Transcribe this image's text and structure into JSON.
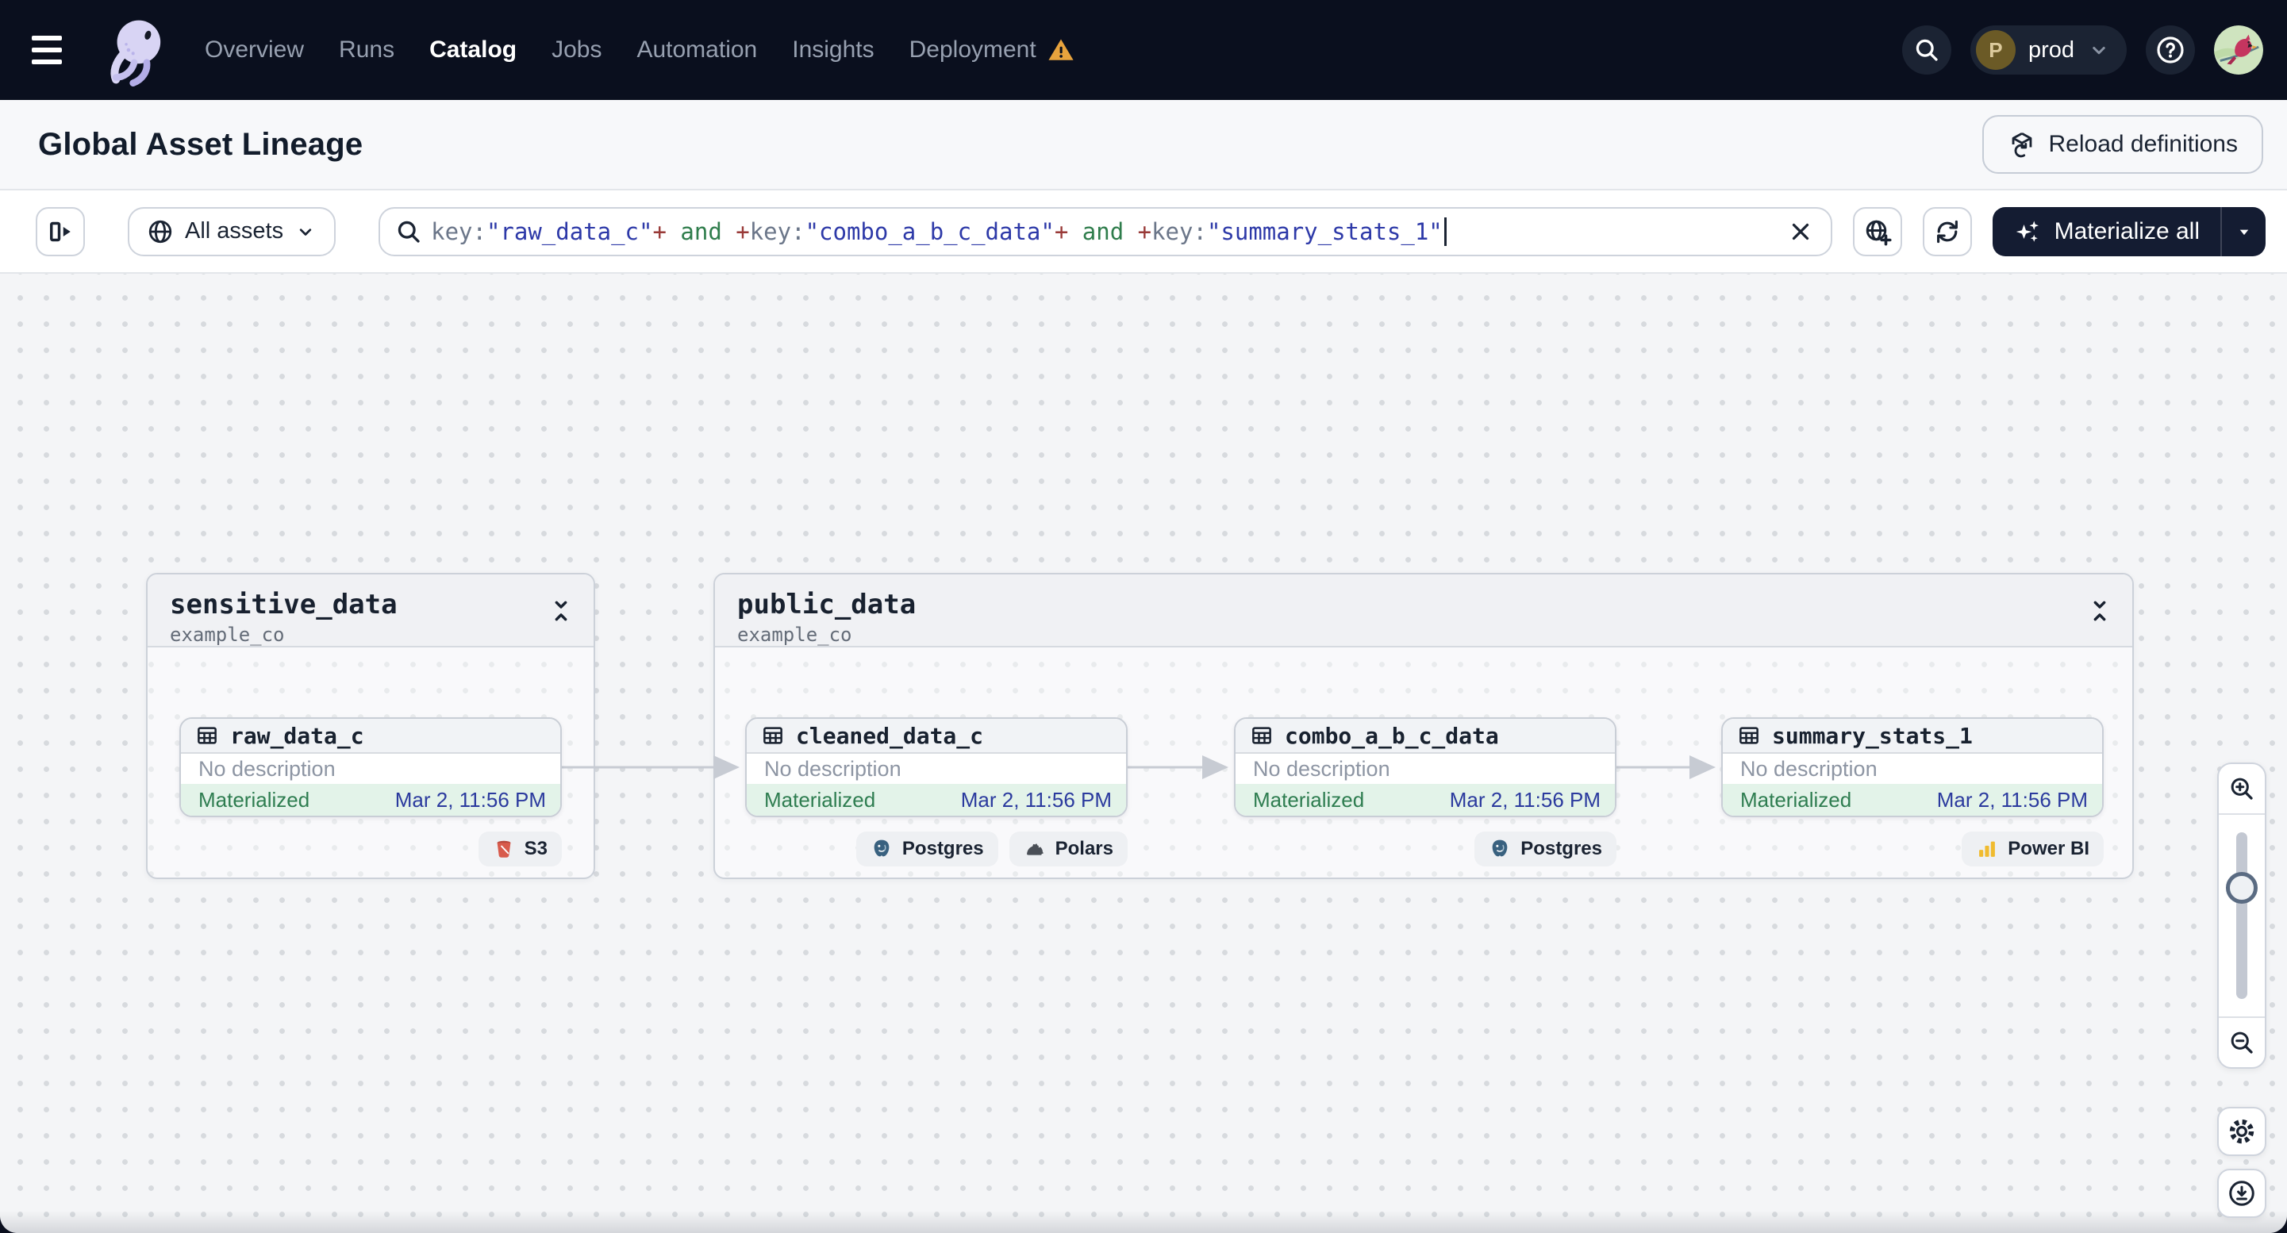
{
  "nav": {
    "logo": "dagster-octopus-logo",
    "items": [
      {
        "label": "Overview",
        "active": false
      },
      {
        "label": "Runs",
        "active": false
      },
      {
        "label": "Catalog",
        "active": true
      },
      {
        "label": "Jobs",
        "active": false
      },
      {
        "label": "Automation",
        "active": false
      },
      {
        "label": "Insights",
        "active": false
      },
      {
        "label": "Deployment",
        "active": false,
        "warning": true
      }
    ],
    "environment": {
      "initial": "P",
      "name": "prod"
    },
    "icons": [
      "search-icon",
      "help-icon",
      "user-avatar"
    ]
  },
  "header": {
    "title": "Global Asset Lineage",
    "reload_label": "Reload definitions"
  },
  "toolbar": {
    "asset_filter_label": "All assets",
    "query_tokens": [
      {
        "text": "key:",
        "color": "gray"
      },
      {
        "text": "\"raw_data_c\"",
        "color": "blue"
      },
      {
        "text": "+",
        "color": "red"
      },
      {
        "text": " and ",
        "color": "green"
      },
      {
        "text": "+",
        "color": "red"
      },
      {
        "text": "key:",
        "color": "gray"
      },
      {
        "text": "\"combo_a_b_c_data\"",
        "color": "blue"
      },
      {
        "text": "+",
        "color": "red"
      },
      {
        "text": " and ",
        "color": "green"
      },
      {
        "text": "+",
        "color": "red"
      },
      {
        "text": "key:",
        "color": "gray"
      },
      {
        "text": "\"summary_stats_1\"",
        "color": "blue"
      }
    ],
    "materialize_label": "Materialize all"
  },
  "graph": {
    "groups": [
      {
        "name": "sensitive_data",
        "location": "example_co"
      },
      {
        "name": "public_data",
        "location": "example_co"
      }
    ],
    "nodes": [
      {
        "name": "raw_data_c",
        "group": 0,
        "description": "No description",
        "status": "Materialized",
        "timestamp": "Mar 2, 11:56 PM",
        "tags": [
          {
            "label": "S3",
            "icon": "s3-bucket-icon"
          }
        ]
      },
      {
        "name": "cleaned_data_c",
        "group": 1,
        "description": "No description",
        "status": "Materialized",
        "timestamp": "Mar 2, 11:56 PM",
        "tags": [
          {
            "label": "Postgres",
            "icon": "postgres-icon"
          },
          {
            "label": "Polars",
            "icon": "polars-icon"
          }
        ]
      },
      {
        "name": "combo_a_b_c_data",
        "group": 1,
        "description": "No description",
        "status": "Materialized",
        "timestamp": "Mar 2, 11:56 PM",
        "tags": [
          {
            "label": "Postgres",
            "icon": "postgres-icon"
          }
        ]
      },
      {
        "name": "summary_stats_1",
        "group": 1,
        "description": "No description",
        "status": "Materialized",
        "timestamp": "Mar 2, 11:56 PM",
        "tags": [
          {
            "label": "Power BI",
            "icon": "powerbi-icon"
          }
        ]
      }
    ],
    "edges": [
      {
        "from": "raw_data_c",
        "to": "cleaned_data_c"
      },
      {
        "from": "cleaned_data_c",
        "to": "combo_a_b_c_data"
      },
      {
        "from": "combo_a_b_c_data",
        "to": "summary_stats_1"
      }
    ]
  },
  "colors": {
    "nav_bg": "#0a0f1e",
    "accent_dark": "#141c32",
    "warning": "#e8a33d",
    "materialized_green": "#2e7d50",
    "timestamp_navy": "#2b3a9e",
    "query_blue": "#2d39a8",
    "query_red": "#993a38",
    "query_green": "#2f7d4c"
  }
}
